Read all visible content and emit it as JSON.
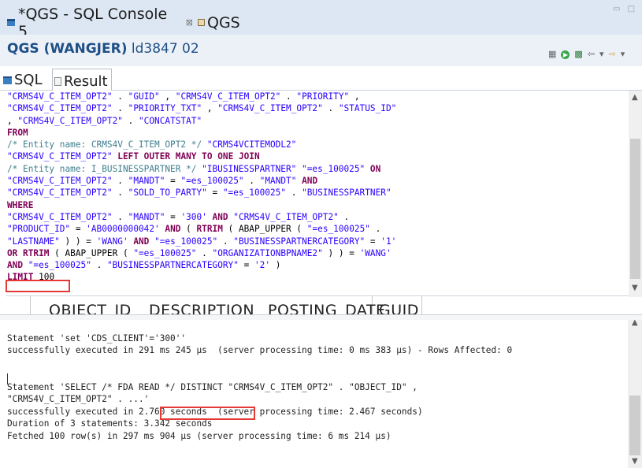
{
  "tabs": {
    "console_label": "*QGS - SQL Console 5",
    "console_close": "⊠",
    "qgs_label": "QGS",
    "window_controls": "▭ □"
  },
  "connection": {
    "system": "QGS (WANGJER)",
    "host": "ld3847 02",
    "toolbar_icons": [
      "layout-icon",
      "run-icon",
      "sql-icon",
      "back-icon",
      "dropdown-icon",
      "forward-icon",
      "dropdown-icon"
    ]
  },
  "subtabs": {
    "sql": "SQL",
    "result": "Result"
  },
  "editor": {
    "lines": [
      [
        [
          "s",
          "\"CRMS4V_C_ITEM_OPT2\""
        ],
        [
          "p",
          " . "
        ],
        [
          "s",
          "\"GUID\""
        ],
        [
          "p",
          " , "
        ],
        [
          "s",
          "\"CRMS4V_C_ITEM_OPT2\""
        ],
        [
          "p",
          " . "
        ],
        [
          "s",
          "\"PRIORITY\""
        ],
        [
          "p",
          " ,"
        ]
      ],
      [
        [
          "s",
          "\"CRMS4V_C_ITEM_OPT2\""
        ],
        [
          "p",
          " . "
        ],
        [
          "s",
          "\"PRIORITY_TXT\""
        ],
        [
          "p",
          " , "
        ],
        [
          "s",
          "\"CRMS4V_C_ITEM_OPT2\""
        ],
        [
          "p",
          " . "
        ],
        [
          "s",
          "\"STATUS_ID\""
        ]
      ],
      [
        [
          "p",
          ", "
        ],
        [
          "s",
          "\"CRMS4V_C_ITEM_OPT2\""
        ],
        [
          "p",
          " . "
        ],
        [
          "s",
          "\"CONCATSTAT\""
        ]
      ],
      [
        [
          "k",
          "FROM"
        ]
      ],
      [
        [
          "c",
          "/* Entity name: CRMS4V_C_ITEM_OPT2 */ "
        ],
        [
          "s",
          "\"CRMS4VCITEMODL2\""
        ]
      ],
      [
        [
          "s",
          "\"CRMS4V_C_ITEM_OPT2\""
        ],
        [
          "p",
          " "
        ],
        [
          "k",
          "LEFT OUTER"
        ],
        [
          "p",
          " "
        ],
        [
          "k",
          "MANY"
        ],
        [
          "p",
          " "
        ],
        [
          "k",
          "TO"
        ],
        [
          "p",
          " "
        ],
        [
          "k",
          "ONE"
        ],
        [
          "p",
          " "
        ],
        [
          "k",
          "JOIN"
        ]
      ],
      [
        [
          "c",
          "/* Entity name: I_BUSINESSPARTNER */ "
        ],
        [
          "s",
          "\"IBUSINESSPARTNER\""
        ],
        [
          "p",
          " "
        ],
        [
          "s",
          "\"=es_100025\""
        ],
        [
          "p",
          " "
        ],
        [
          "k",
          "ON"
        ]
      ],
      [
        [
          "s",
          "\"CRMS4V_C_ITEM_OPT2\""
        ],
        [
          "p",
          " . "
        ],
        [
          "s",
          "\"MANDT\""
        ],
        [
          "p",
          " = "
        ],
        [
          "s",
          "\"=es_100025\""
        ],
        [
          "p",
          " . "
        ],
        [
          "s",
          "\"MANDT\""
        ],
        [
          "p",
          " "
        ],
        [
          "k",
          "AND"
        ]
      ],
      [
        [
          "s",
          "\"CRMS4V_C_ITEM_OPT2\""
        ],
        [
          "p",
          " . "
        ],
        [
          "s",
          "\"SOLD_TO_PARTY\""
        ],
        [
          "p",
          " = "
        ],
        [
          "s",
          "\"=es_100025\""
        ],
        [
          "p",
          " . "
        ],
        [
          "s",
          "\"BUSINESSPARTNER\""
        ]
      ],
      [
        [
          "k",
          "WHERE"
        ]
      ],
      [
        [
          "s",
          "\"CRMS4V_C_ITEM_OPT2\""
        ],
        [
          "p",
          " . "
        ],
        [
          "s",
          "\"MANDT\""
        ],
        [
          "p",
          " = "
        ],
        [
          "s",
          "'300'"
        ],
        [
          "p",
          " "
        ],
        [
          "k",
          "AND"
        ],
        [
          "p",
          " "
        ],
        [
          "s",
          "\"CRMS4V_C_ITEM_OPT2\""
        ],
        [
          "p",
          " ."
        ]
      ],
      [
        [
          "s",
          "\"PRODUCT_ID\""
        ],
        [
          "p",
          " = "
        ],
        [
          "s",
          "'AB0000000042'"
        ],
        [
          "p",
          " "
        ],
        [
          "k",
          "AND"
        ],
        [
          "p",
          " ( "
        ],
        [
          "k",
          "RTRIM"
        ],
        [
          "p",
          " ( ABAP_UPPER ( "
        ],
        [
          "s",
          "\"=es_100025\""
        ],
        [
          "p",
          " ."
        ]
      ],
      [
        [
          "s",
          "\"LASTNAME\""
        ],
        [
          "p",
          " ) ) = "
        ],
        [
          "s",
          "'WANG'"
        ],
        [
          "p",
          " "
        ],
        [
          "k",
          "AND"
        ],
        [
          "p",
          " "
        ],
        [
          "s",
          "\"=es_100025\""
        ],
        [
          "p",
          " . "
        ],
        [
          "s",
          "\"BUSINESSPARTNERCATEGORY\""
        ],
        [
          "p",
          " = "
        ],
        [
          "s",
          "'1'"
        ]
      ],
      [
        [
          "k",
          "OR"
        ],
        [
          "p",
          " "
        ],
        [
          "k",
          "RTRIM"
        ],
        [
          "p",
          " ( ABAP_UPPER ( "
        ],
        [
          "s",
          "\"=es_100025\""
        ],
        [
          "p",
          " . "
        ],
        [
          "s",
          "\"ORGANIZATIONBPNAME2\""
        ],
        [
          "p",
          " ) ) = "
        ],
        [
          "s",
          "'WANG'"
        ]
      ],
      [
        [
          "k",
          "AND"
        ],
        [
          "p",
          " "
        ],
        [
          "s",
          "\"=es_100025\""
        ],
        [
          "p",
          " . "
        ],
        [
          "s",
          "\"BUSINESSPARTNERCATEGORY\""
        ],
        [
          "p",
          " = "
        ],
        [
          "s",
          "'2'"
        ],
        [
          "p",
          " )"
        ]
      ],
      [
        [
          "k",
          "LIMIT"
        ],
        [
          "p",
          " 100"
        ]
      ]
    ]
  },
  "result_columns": [
    "OBJECT_ID",
    "DESCRIPTION",
    "POSTING_DATE",
    "GUID"
  ],
  "console": {
    "lines": [
      "",
      "Statement 'set 'CDS_CLIENT'='300''",
      "successfully executed in 291 ms 245 µs  (server processing time: 0 ms 383 µs) - Rows Affected: 0",
      "",
      "",
      "Statement 'SELECT /* FDA READ */ DISTINCT \"CRMS4V_C_ITEM_OPT2\" . \"OBJECT_ID\" ,",
      "\"CRMS4V_C_ITEM_OPT2\" . ...'",
      "successfully executed in 2.760 seconds  (server processing time: 2.467 seconds)",
      "Duration of 3 statements: 3.342 seconds",
      "Fetched 100 row(s) in 297 ms 904 µs (server processing time: 6 ms 214 µs)"
    ]
  },
  "colors": {
    "highlight_box": "#e53935",
    "sql_string": "#2a00ff",
    "sql_keyword": "#7f0055",
    "sql_comment": "#3f7f8f"
  }
}
